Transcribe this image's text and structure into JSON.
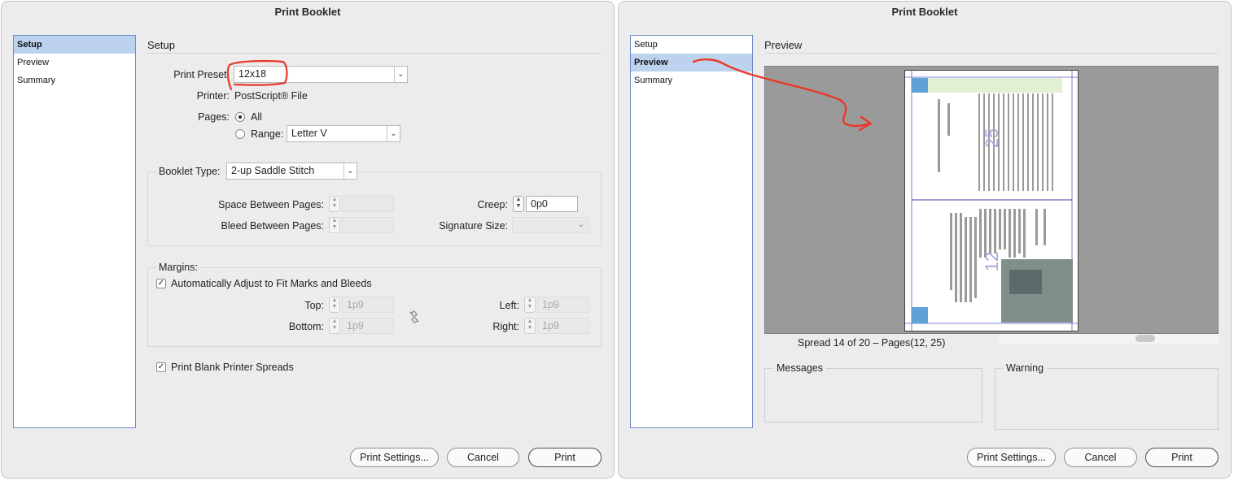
{
  "left_dialog": {
    "title": "Print Booklet",
    "nav": [
      "Setup",
      "Preview",
      "Summary"
    ],
    "section_title": "Setup",
    "print_preset": {
      "label": "Print Preset:",
      "value": "12x18"
    },
    "printer": {
      "label": "Printer:",
      "value": "PostScript® File"
    },
    "pages": {
      "label": "Pages:",
      "all_label": "All",
      "range_label": "Range:",
      "range_value": "Letter V"
    },
    "booklet_type": {
      "label": "Booklet Type:",
      "value": "2-up Saddle Stitch"
    },
    "space_between_pages_label": "Space Between Pages:",
    "bleed_between_pages_label": "Bleed Between Pages:",
    "creep": {
      "label": "Creep:",
      "value": "0p0"
    },
    "signature_size_label": "Signature Size:",
    "margins": {
      "label": "Margins:",
      "auto_adjust_label": "Automatically Adjust to Fit Marks and Bleeds",
      "top": {
        "label": "Top:",
        "value": "1p9"
      },
      "bottom": {
        "label": "Bottom:",
        "value": "1p9"
      },
      "left": {
        "label": "Left:",
        "value": "1p9"
      },
      "right": {
        "label": "Right:",
        "value": "1p9"
      }
    },
    "print_blank_label": "Print Blank Printer Spreads",
    "buttons": {
      "print_settings": "Print Settings...",
      "cancel": "Cancel",
      "print": "Print"
    }
  },
  "right_dialog": {
    "title": "Print Booklet",
    "nav": [
      "Setup",
      "Preview",
      "Summary"
    ],
    "section_title": "Preview",
    "spread_text": "Spread 14 of 20 – Pages(12, 25)",
    "page_numbers": {
      "top": "25",
      "bottom": "12"
    },
    "messages_label": "Messages",
    "warning_label": "Warning",
    "buttons": {
      "print_settings": "Print Settings...",
      "cancel": "Cancel",
      "print": "Print"
    }
  },
  "colors": {
    "annotation_red": "#e8392a",
    "selection": "#bcd2ee",
    "nav_border": "#6d8ac8"
  }
}
